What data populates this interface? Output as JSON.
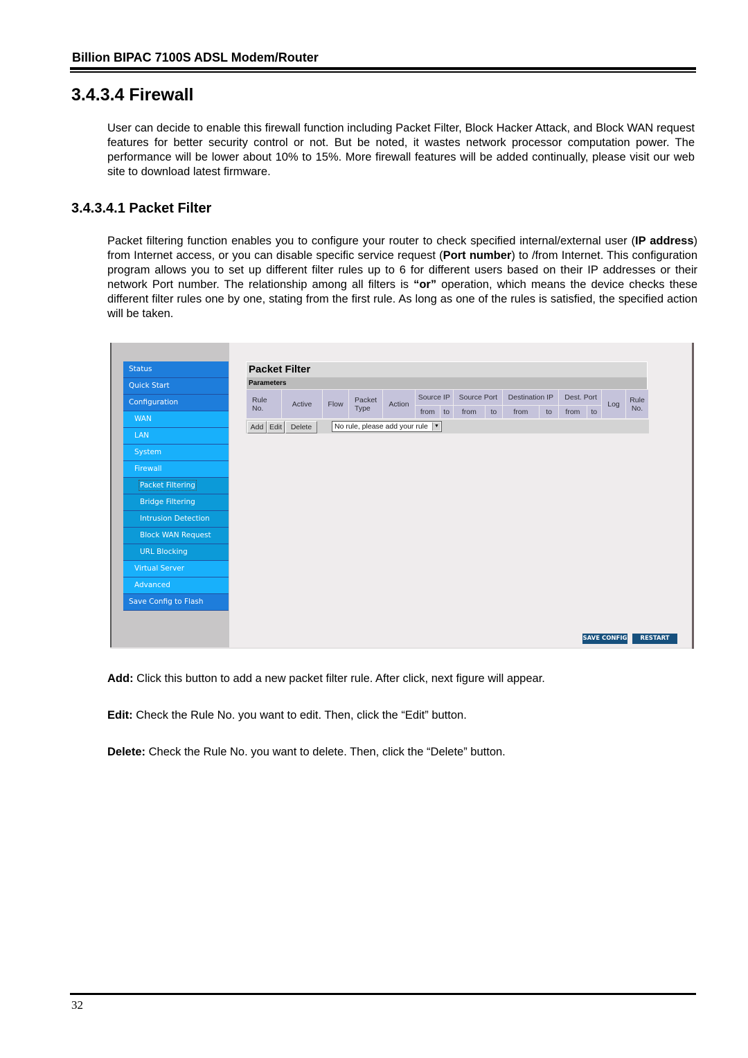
{
  "doc": {
    "running_header": "Billion BIPAC 7100S ADSL Modem/Router",
    "section_title": "3.4.3.4 Firewall",
    "section_paragraph": "User can decide to enable this firewall function including Packet Filter, Block Hacker Attack, and Block WAN request features for better security control or not. But be noted, it wastes network processor computation power. The performance will be lower about 10% to 15%. More firewall features will be added continually, please visit our web site to download latest firmware.",
    "subsection_title": "3.4.3.4.1 Packet Filter",
    "subsection_paragraph": {
      "t1": "Packet filtering function enables you to configure your router to check specified internal/external user (",
      "b1": "IP address",
      "t2": ") from Internet access, or you can disable specific service request (",
      "b2": "Port number",
      "t3": ") to /from Internet. This configuration program allows you to set up different filter rules up to 6 for different users based on their IP addresses or their network Port number. The relationship among all filters is ",
      "b3": "“or”",
      "t4": " operation, which means the device checks these different filter rules one by one, stating from the first rule. As long as one of the rules is satisfied, the specified action will be taken."
    },
    "descriptions": [
      {
        "term": "Add:",
        "text": " Click this button to add a new packet filter rule. After click, next figure will appear."
      },
      {
        "term": "Edit:",
        "text": " Check the Rule No. you want to edit. Then, click the “Edit” button."
      },
      {
        "term": "Delete:",
        "text": " Check the Rule No. you want to delete. Then, click the “Delete” button."
      }
    ],
    "page_number": "32"
  },
  "router_ui": {
    "nav": [
      {
        "label": "Status",
        "level": 0
      },
      {
        "label": "Quick Start",
        "level": 0
      },
      {
        "label": "Configuration",
        "level": 0
      },
      {
        "label": "WAN",
        "level": 1
      },
      {
        "label": "LAN",
        "level": 1
      },
      {
        "label": "System",
        "level": 1
      },
      {
        "label": "Firewall",
        "level": 1
      },
      {
        "label": "Packet Filtering",
        "level": 2,
        "selected": true
      },
      {
        "label": "Bridge Filtering",
        "level": 2
      },
      {
        "label": "Intrusion Detection",
        "level": 2
      },
      {
        "label": "Block WAN Request",
        "level": 2
      },
      {
        "label": "URL Blocking",
        "level": 2
      },
      {
        "label": "Virtual Server",
        "level": 1
      },
      {
        "label": "Advanced",
        "level": 1
      },
      {
        "label": "Save Config to Flash",
        "level": 0
      }
    ],
    "panel_title": "Packet Filter",
    "panel_subtitle": "Parameters",
    "columns": {
      "rule_no": "Rule No.",
      "active": "Active",
      "flow": "Flow",
      "packet_type": "Packet Type",
      "action": "Action",
      "source_ip": "Source IP",
      "source_port": "Source Port",
      "destination_ip": "Destination IP",
      "dest_port": "Dest. Port",
      "log": "Log",
      "rule_no_right": "Rule No.",
      "from": "from",
      "to": "to"
    },
    "buttons": {
      "add": "Add",
      "edit": "Edit",
      "delete": "Delete",
      "save_config": "SAVE CONFIG",
      "restart": "RESTART"
    },
    "rule_select": {
      "value": "No rule, please add your rule"
    },
    "colors": {
      "nav_top": "#1e7ddb",
      "nav_sub": "#18b0fb",
      "nav_subsub": "#0c9ad8",
      "table_header": "#c5c3db",
      "action_button": "#17507d"
    }
  }
}
